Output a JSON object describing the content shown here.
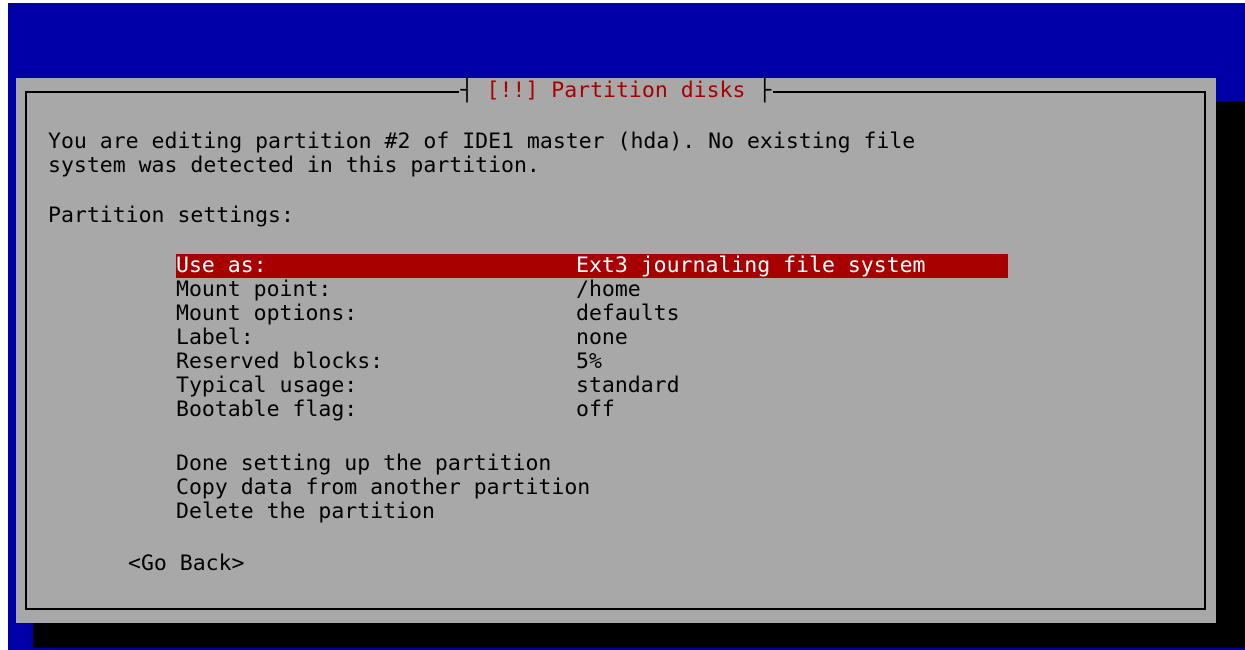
{
  "dialog": {
    "title": "[!!] Partition disks",
    "title_left_tee": "┤",
    "title_right_tee": "├",
    "description_line1": "You are editing partition #2 of IDE1 master (hda). No existing file",
    "description_line2": "system was detected in this partition.",
    "settings_heading": "Partition settings:",
    "settings": [
      {
        "key": "Use as:",
        "value": "Ext3 journaling file system"
      },
      {
        "key": "Mount point:",
        "value": "/home"
      },
      {
        "key": "Mount options:",
        "value": "defaults"
      },
      {
        "key": "Label:",
        "value": "none"
      },
      {
        "key": "Reserved blocks:",
        "value": "5%"
      },
      {
        "key": "Typical usage:",
        "value": "standard"
      },
      {
        "key": "Bootable flag:",
        "value": "off"
      }
    ],
    "actions": [
      "Done setting up the partition",
      "Copy data from another partition",
      "Delete the partition"
    ],
    "go_back": "<Go Back>"
  },
  "colors": {
    "background_blue": "#0000a8",
    "dialog_gray": "#a8a8a8",
    "highlight_red": "#a80000",
    "title_red": "#a80000",
    "shadow_black": "#000000"
  }
}
